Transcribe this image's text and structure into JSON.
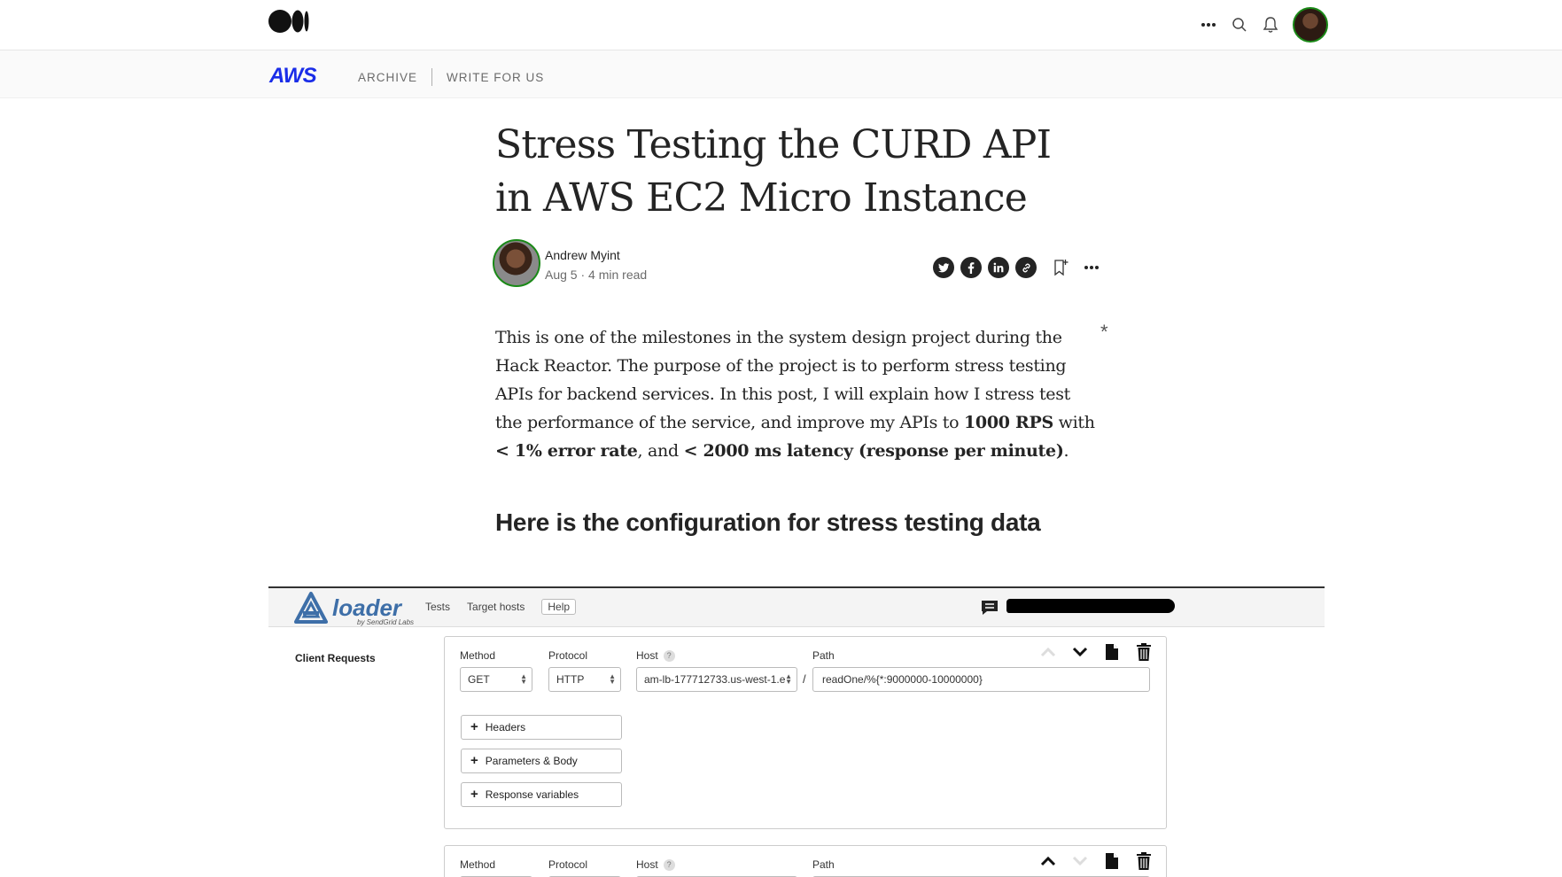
{
  "topbar": {
    "logo_icon": "medium-logo",
    "icons": [
      "more-dots-icon",
      "search-icon",
      "bell-icon"
    ]
  },
  "publication": {
    "logo": "AWS",
    "nav": [
      "ARCHIVE",
      "WRITE FOR US"
    ]
  },
  "article": {
    "title": "Stress Testing the CURD API in AWS EC2 Micro Instance",
    "author": "Andrew Myint",
    "meta": "Aug 5 · 4 min read",
    "share_icons": [
      "twitter-icon",
      "facebook-icon",
      "linkedin-icon",
      "link-icon",
      "bookmark-icon",
      "more-icon"
    ],
    "body": {
      "p1": "This is one of the milestones in the system design project during the Hack Reactor. The purpose of the project is to perform stress testing APIs for backend services. In this post, I will explain how I stress test the performance of the service, and improve my APIs to ",
      "b1": "1000 RPS",
      "p2": " with ",
      "b2": "< 1% error rate",
      "p3": ", and ",
      "b3": "< 2000 ms latency (response per minute)",
      "p4": "."
    },
    "asterisk": "*",
    "heading": "Here is the configuration for stress testing data"
  },
  "loader": {
    "logo_word": "loader",
    "logo_sub": "by SendGrid Labs",
    "nav": [
      "Tests",
      "Target hosts",
      "Help"
    ],
    "client_requests": "Client Requests",
    "request1": {
      "method_label": "Method",
      "method": "GET",
      "protocol_label": "Protocol",
      "protocol": "HTTP",
      "host_label": "Host",
      "host_help": "?",
      "host": "am-lb-177712733.us-west-1.e",
      "slash": "/",
      "path_label": "Path",
      "path": "readOne/%{*:9000000-10000000}",
      "buttons": [
        "Headers",
        "Parameters & Body",
        "Response variables"
      ]
    },
    "request2": {
      "method_label": "Method",
      "protocol_label": "Protocol",
      "host_label": "Host",
      "host_help": "?",
      "path_label": "Path"
    }
  }
}
